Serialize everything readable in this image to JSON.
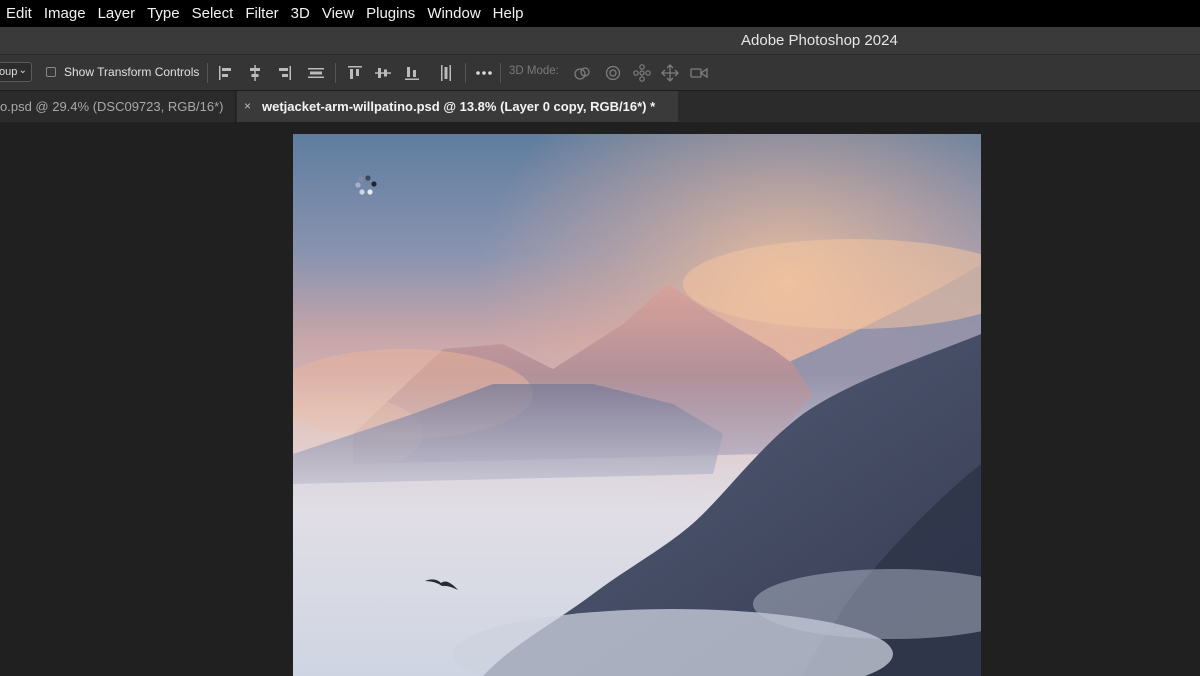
{
  "menubar": {
    "items": [
      "Edit",
      "Image",
      "Layer",
      "Type",
      "Select",
      "Filter",
      "3D",
      "View",
      "Plugins",
      "Window",
      "Help"
    ]
  },
  "titlebar": {
    "title": "Adobe Photoshop 2024"
  },
  "options": {
    "auto_select_value": "oup",
    "show_transform_label": "Show Transform Controls",
    "mode_label": "3D Mode:",
    "icons": [
      "align-left-edges-icon",
      "align-horizontal-centers-icon",
      "align-right-edges-icon",
      "distribute-horizontal-icon",
      "align-top-edges-icon",
      "align-vertical-centers-icon",
      "align-bottom-edges-icon",
      "distribute-vertical-icon",
      "more-options-icon",
      "orbit-3d-icon",
      "roll-3d-icon",
      "pan-3d-icon",
      "slide-3d-icon",
      "scale-3d-icon"
    ]
  },
  "tabs": [
    {
      "label": "o.psd @ 29.4% (DSC09723, RGB/16*)",
      "active": false
    },
    {
      "label": "wetjacket-arm-willpatino.psd @ 13.8% (Layer 0 copy, RGB/16*) *",
      "active": true,
      "close": "×"
    }
  ],
  "canvas": {
    "image": "misty-mountain-landscape",
    "spinner": "loading-spinner-icon"
  },
  "colors": {
    "menubar_bg": "#000000",
    "titlebar_bg": "#3a3a3a",
    "optionsbar_bg": "#353535",
    "workspace_bg": "#202020",
    "active_tab_bg": "#3a3a3a"
  }
}
